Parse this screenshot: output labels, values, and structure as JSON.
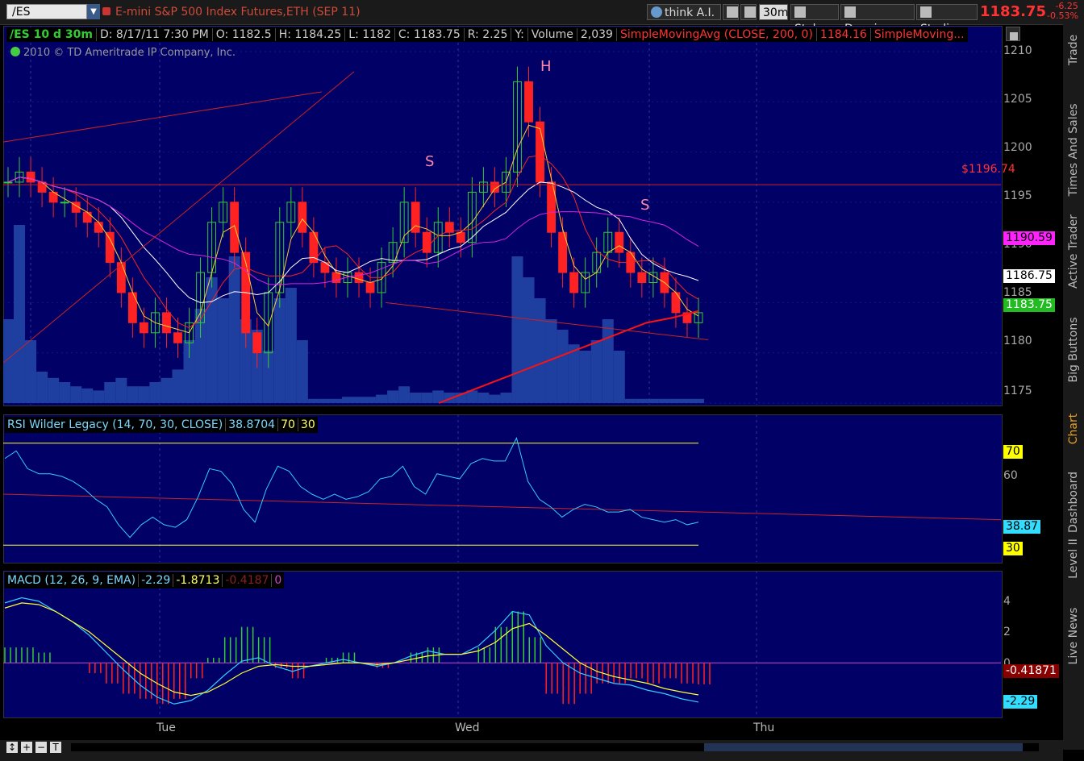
{
  "toolbar": {
    "symbol": "/ES",
    "description": "E-mini S&P 500 Index Futures,ETH (SEP 11)",
    "think_ai": "think A.I.",
    "timeframe": "30m",
    "style": "Style",
    "drawings": "Drawings",
    "studies": "Studies",
    "last": "1183.75",
    "change": "-6.25",
    "change_pct": "-0.53%"
  },
  "side_tabs": [
    "Trade",
    "Times And Sales",
    "Active Trader",
    "Big Buttons",
    "Chart",
    "Dashboard",
    "Level II",
    "Live News"
  ],
  "price_pane": {
    "header": [
      "/ES 10 d 30m",
      "D: 8/17/11 7:30 PM",
      "O: 1182.5",
      "H: 1184.25",
      "L: 1182",
      "C: 1183.75",
      "R: 2.25",
      "Y:",
      "Volume",
      "2,039",
      "SimpleMovingAvg (CLOSE, 200, 0)",
      "1184.16",
      "SimpleMoving..."
    ],
    "copyright": "2010 © TD Ameritrade IP Company, Inc.",
    "y_ticks": [
      "1210",
      "1205",
      "1200",
      "1195",
      "1190",
      "1185",
      "1180",
      "1175"
    ],
    "line_label": "$1196.74",
    "tags": {
      "sma_magenta": "1190.59",
      "sma_white": "1186.75",
      "last": "1183.75"
    },
    "annotations": [
      "H",
      "S",
      "S"
    ]
  },
  "rsi_pane": {
    "header": [
      "RSI Wilder Legacy (14, 70, 30, CLOSE)",
      "38.8704",
      "70",
      "30"
    ],
    "y_ticks": [
      "60"
    ],
    "tags": {
      "ob": "70",
      "value": "38.87",
      "os": "30"
    }
  },
  "macd_pane": {
    "header": [
      "MACD (12, 26, 9, EMA)",
      "-2.29",
      "-1.8713",
      "-0.4187",
      "0"
    ],
    "y_ticks": [
      "4",
      "2",
      "0"
    ],
    "tags": {
      "hist": "-0.41871",
      "value": "-2.29"
    }
  },
  "x_labels": [
    "Tue",
    "Wed",
    "Thu"
  ],
  "colors": {
    "pane_bg": "#000066",
    "up": "#33cc33",
    "down": "#ff2222",
    "volume": "#1f3fa0",
    "sma_white": "#ffffff",
    "sma_magenta": "#dd22dd",
    "sma_red": "#ff2222"
  },
  "chart_data": [
    {
      "type": "line",
      "title": "/ES 10 d 30m",
      "ylim": [
        1175,
        1210
      ],
      "series": [
        {
          "name": "Close",
          "values": [
            1197,
            1198,
            1197,
            1196,
            1195,
            1195,
            1194,
            1193,
            1192,
            1189,
            1186,
            1183,
            1182,
            1184,
            1182,
            1181,
            1183,
            1188,
            1193,
            1195,
            1190,
            1182,
            1180,
            1186,
            1193,
            1195,
            1192,
            1189,
            1188,
            1187,
            1188,
            1187,
            1186,
            1189,
            1191,
            1195,
            1192,
            1190,
            1193,
            1192,
            1191,
            1196,
            1197,
            1196,
            1198,
            1207,
            1203,
            1197,
            1192,
            1188,
            1186,
            1188,
            1190,
            1192,
            1190,
            1188,
            1187,
            1188,
            1186,
            1184,
            1183,
            1184
          ]
        },
        {
          "name": "SimpleMovingAvg (CLOSE, 200, 0)",
          "values": [
            1175,
            1176,
            1177,
            1178,
            1179,
            1180,
            1181,
            1182,
            1183,
            1183.5,
            1184.16
          ]
        }
      ]
    },
    {
      "type": "line",
      "title": "RSI Wilder Legacy (14, 70, 30, CLOSE)",
      "ylim": [
        25,
        75
      ],
      "series": [
        {
          "name": "RSI",
          "values": [
            64,
            67,
            60,
            58,
            58,
            57,
            55,
            52,
            48,
            45,
            38,
            33,
            38,
            41,
            38,
            37,
            40,
            49,
            60,
            59,
            54,
            44,
            39,
            52,
            61,
            59,
            53,
            50,
            48,
            50,
            48,
            49,
            51,
            56,
            57,
            61,
            53,
            50,
            58,
            57,
            56,
            62,
            64,
            63,
            63,
            72,
            55,
            48,
            45,
            41,
            44,
            46,
            45,
            43,
            43,
            44,
            41,
            40,
            39,
            40,
            38,
            39
          ]
        }
      ]
    },
    {
      "type": "line",
      "title": "MACD (12, 26, 9, EMA)",
      "ylim": [
        -3,
        5
      ],
      "series": [
        {
          "name": "MACD",
          "values": [
            3.5,
            3.8,
            3.6,
            3.0,
            2.4,
            1.6,
            0.6,
            -0.4,
            -1.3,
            -2.0,
            -2.4,
            -2.2,
            -1.6,
            -0.7,
            0.1,
            0.3,
            -0.2,
            -0.5,
            -0.2,
            0.0,
            0.2,
            0.0,
            -0.2,
            0.0,
            0.4,
            0.7,
            0.5,
            0.5,
            1.0,
            1.9,
            3.0,
            2.8,
            1.0,
            0.0,
            -0.6,
            -0.9,
            -1.2,
            -1.3,
            -1.6,
            -1.8,
            -2.1,
            -2.29
          ]
        },
        {
          "name": "Signal",
          "values": [
            3.2,
            3.5,
            3.4,
            3.0,
            2.4,
            1.8,
            1.0,
            0.2,
            -0.6,
            -1.2,
            -1.7,
            -1.9,
            -1.7,
            -1.2,
            -0.6,
            -0.2,
            -0.1,
            -0.2,
            -0.2,
            -0.1,
            0.0,
            0.0,
            -0.1,
            0.0,
            0.2,
            0.4,
            0.5,
            0.5,
            0.7,
            1.2,
            2.0,
            2.3,
            1.6,
            0.8,
            0.0,
            -0.5,
            -0.8,
            -1.0,
            -1.2,
            -1.5,
            -1.7,
            -1.87
          ]
        }
      ]
    }
  ]
}
